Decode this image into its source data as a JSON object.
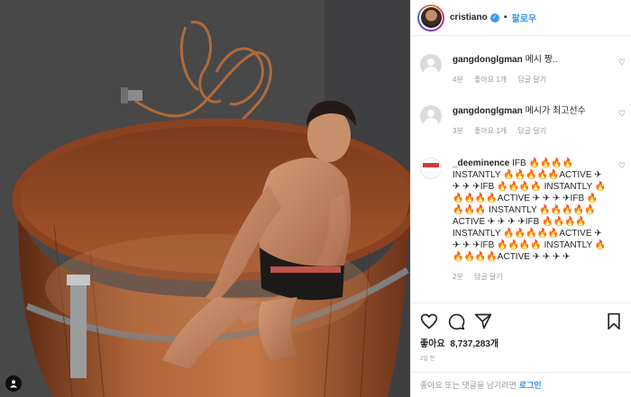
{
  "post": {
    "username": "cristiano",
    "follow_label": "팔로우",
    "separator": "•"
  },
  "comments": [
    {
      "username": "gangdonglgman",
      "text": "메시 짱..",
      "time": "4분",
      "likes": "좋아요 1개",
      "reply": "답글 달기"
    },
    {
      "username": "gangdonglgman",
      "text": "메시가 최고선수",
      "time": "3분",
      "likes": "좋아요 1개",
      "reply": "답글 달기"
    },
    {
      "username": "_deeminence",
      "text": "IFB 🔥🔥🔥🔥 INSTANTLY 🔥🔥🔥🔥🔥ACTIVE ✈ ✈ ✈ ✈IFB 🔥🔥🔥🔥 INSTANTLY 🔥🔥🔥🔥🔥ACTIVE ✈ ✈ ✈ ✈IFB 🔥🔥🔥🔥 INSTANTLY 🔥🔥🔥🔥🔥ACTIVE ✈ ✈ ✈ ✈IFB 🔥🔥🔥🔥 INSTANTLY 🔥🔥🔥🔥🔥ACTIVE ✈ ✈ ✈ ✈IFB 🔥🔥🔥🔥 INSTANTLY 🔥🔥🔥🔥🔥ACTIVE ✈ ✈ ✈ ✈",
      "time": "2분",
      "reply": "답글 달기"
    }
  ],
  "actions": {
    "like_icon": "heart-icon",
    "comment_icon": "comment-icon",
    "share_icon": "share-icon",
    "save_icon": "bookmark-icon",
    "likes_label": "좋아요",
    "likes_count": "8,737,283개",
    "time": "2일 전"
  },
  "login_prompt": {
    "text": "좋아요 또는 댓글을 남기려면",
    "link": "로그인"
  },
  "colors": {
    "accent": "#3897f0",
    "text": "#262626",
    "muted": "#999999",
    "border": "#efefef"
  }
}
